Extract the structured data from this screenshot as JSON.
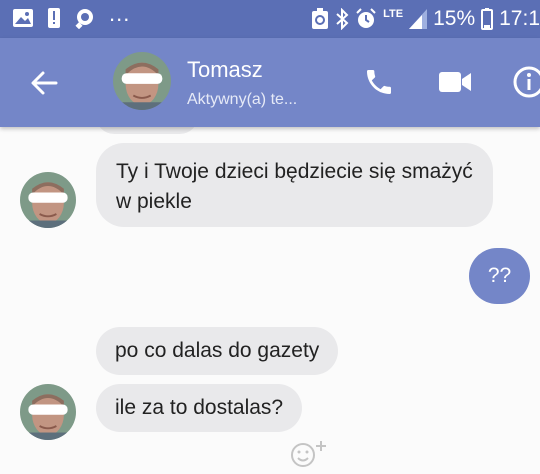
{
  "status_bar": {
    "battery": "15%",
    "time": "17:1",
    "network": "LTE",
    "dots": "..."
  },
  "header": {
    "name": "Tomasz",
    "status": "Aktywny(a) te..."
  },
  "messages": [
    {
      "direction": "incoming",
      "text": "Ty i Twoje dzieci będziecie się smażyć w piekle"
    },
    {
      "direction": "outgoing",
      "text": "??"
    },
    {
      "direction": "incoming",
      "text": "po co dalas do gazety"
    },
    {
      "direction": "incoming",
      "text": "ile za to dostalas?"
    }
  ],
  "icons": {
    "back": "arrow-back-icon",
    "call": "phone-icon",
    "video": "video-camera-icon",
    "info": "info-icon",
    "reaction": "add-reaction-icon"
  },
  "colors": {
    "status_bar": "#5b6fb5",
    "header": "#7486c8",
    "incoming_bubble": "#e9e9eb",
    "outgoing_bubble": "#7486c8",
    "background": "#fbfbfb"
  }
}
